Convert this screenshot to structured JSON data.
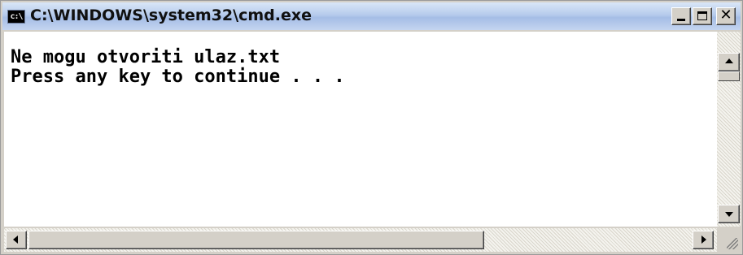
{
  "window": {
    "title": "C:\\WINDOWS\\system32\\cmd.exe",
    "icon": "cmd-icon",
    "icon_text": "c:\\",
    "controls": [
      "minimize-icon",
      "maximize-icon",
      "close-icon"
    ],
    "close_glyph": "✕"
  },
  "console": {
    "lines": [
      "Ne mogu otvoriti ulaz.txt",
      "Press any key to continue . . ."
    ],
    "text_color": "#000000",
    "background": "#ffffff"
  },
  "colors": {
    "chrome": "#d4d0c8",
    "titlebar": "#b6cbec"
  }
}
